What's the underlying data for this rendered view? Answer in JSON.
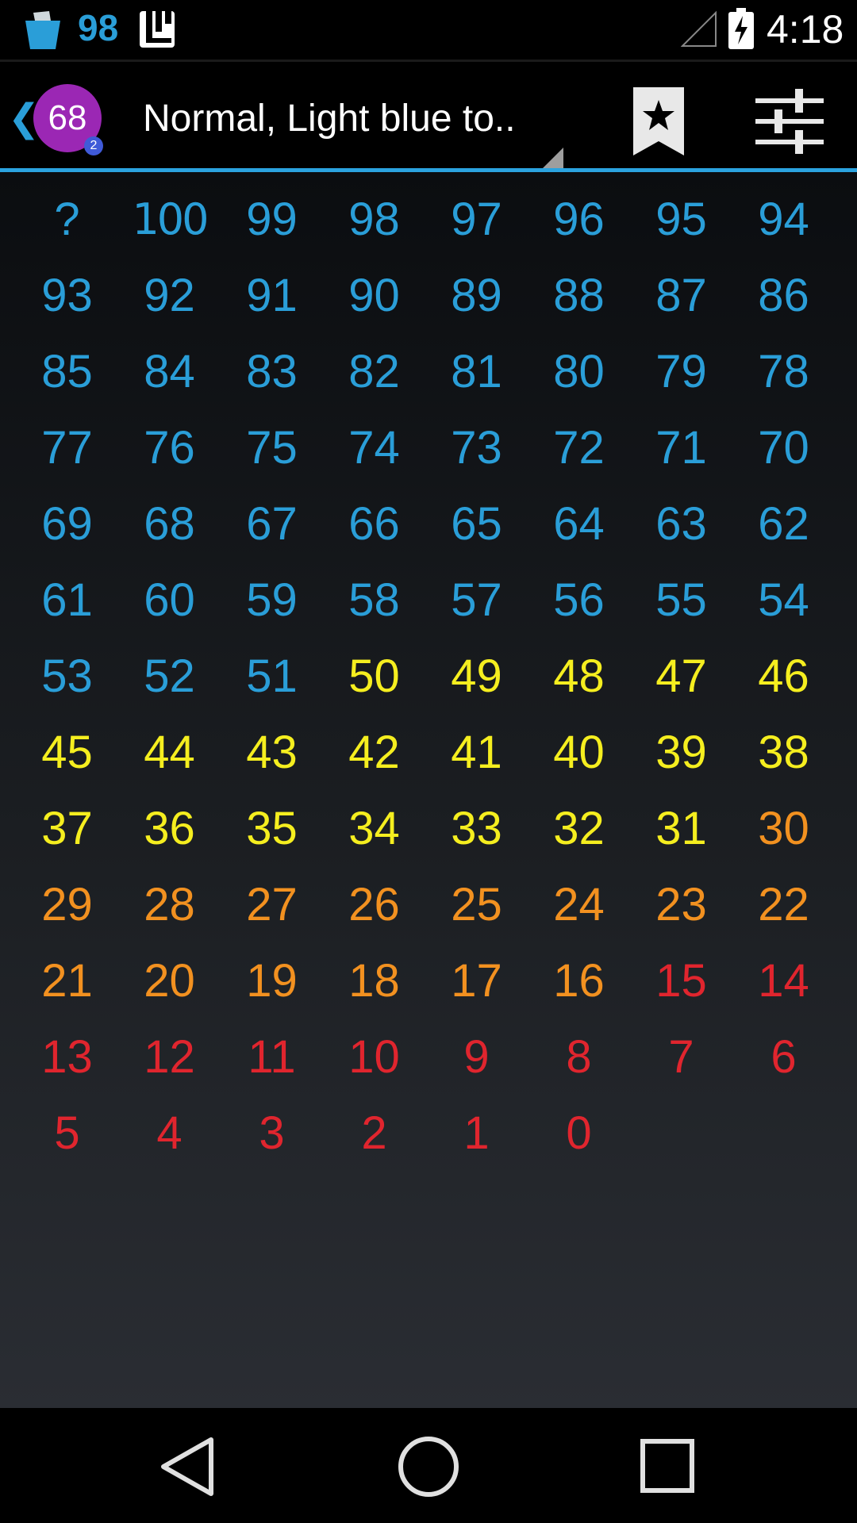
{
  "status_bar": {
    "battery_level": "98",
    "time": "4:18",
    "icons": [
      "bucket-app-icon",
      "notification-icon",
      "signal-icon",
      "battery-charging-icon"
    ]
  },
  "action_bar": {
    "back_glyph": "❮",
    "avatar_number": "68",
    "avatar_badge": "2",
    "spinner_value": "Normal, Light blue to..",
    "icons": [
      "bookmark-star-icon",
      "settings-sliders-icon"
    ]
  },
  "colors": {
    "accent": "#2ba3df",
    "avatar": "#9b27b4",
    "light_blue": "#2a9ed8",
    "yellow": "#f5ee1f",
    "orange": "#f29120",
    "red": "#e0252e"
  },
  "grid": {
    "cells": [
      {
        "label": "?",
        "color": "light_blue"
      },
      {
        "label": "100",
        "color": "light_blue"
      },
      {
        "label": "99",
        "color": "light_blue"
      },
      {
        "label": "98",
        "color": "light_blue"
      },
      {
        "label": "97",
        "color": "light_blue"
      },
      {
        "label": "96",
        "color": "light_blue"
      },
      {
        "label": "95",
        "color": "light_blue"
      },
      {
        "label": "94",
        "color": "light_blue"
      },
      {
        "label": "93",
        "color": "light_blue"
      },
      {
        "label": "92",
        "color": "light_blue"
      },
      {
        "label": "91",
        "color": "light_blue"
      },
      {
        "label": "90",
        "color": "light_blue"
      },
      {
        "label": "89",
        "color": "light_blue"
      },
      {
        "label": "88",
        "color": "light_blue"
      },
      {
        "label": "87",
        "color": "light_blue"
      },
      {
        "label": "86",
        "color": "light_blue"
      },
      {
        "label": "85",
        "color": "light_blue"
      },
      {
        "label": "84",
        "color": "light_blue"
      },
      {
        "label": "83",
        "color": "light_blue"
      },
      {
        "label": "82",
        "color": "light_blue"
      },
      {
        "label": "81",
        "color": "light_blue"
      },
      {
        "label": "80",
        "color": "light_blue"
      },
      {
        "label": "79",
        "color": "light_blue"
      },
      {
        "label": "78",
        "color": "light_blue"
      },
      {
        "label": "77",
        "color": "light_blue"
      },
      {
        "label": "76",
        "color": "light_blue"
      },
      {
        "label": "75",
        "color": "light_blue"
      },
      {
        "label": "74",
        "color": "light_blue"
      },
      {
        "label": "73",
        "color": "light_blue"
      },
      {
        "label": "72",
        "color": "light_blue"
      },
      {
        "label": "71",
        "color": "light_blue"
      },
      {
        "label": "70",
        "color": "light_blue"
      },
      {
        "label": "69",
        "color": "light_blue"
      },
      {
        "label": "68",
        "color": "light_blue"
      },
      {
        "label": "67",
        "color": "light_blue"
      },
      {
        "label": "66",
        "color": "light_blue"
      },
      {
        "label": "65",
        "color": "light_blue"
      },
      {
        "label": "64",
        "color": "light_blue"
      },
      {
        "label": "63",
        "color": "light_blue"
      },
      {
        "label": "62",
        "color": "light_blue"
      },
      {
        "label": "61",
        "color": "light_blue"
      },
      {
        "label": "60",
        "color": "light_blue"
      },
      {
        "label": "59",
        "color": "light_blue"
      },
      {
        "label": "58",
        "color": "light_blue"
      },
      {
        "label": "57",
        "color": "light_blue"
      },
      {
        "label": "56",
        "color": "light_blue"
      },
      {
        "label": "55",
        "color": "light_blue"
      },
      {
        "label": "54",
        "color": "light_blue"
      },
      {
        "label": "53",
        "color": "light_blue"
      },
      {
        "label": "52",
        "color": "light_blue"
      },
      {
        "label": "51",
        "color": "light_blue"
      },
      {
        "label": "50",
        "color": "yellow"
      },
      {
        "label": "49",
        "color": "yellow"
      },
      {
        "label": "48",
        "color": "yellow"
      },
      {
        "label": "47",
        "color": "yellow"
      },
      {
        "label": "46",
        "color": "yellow"
      },
      {
        "label": "45",
        "color": "yellow"
      },
      {
        "label": "44",
        "color": "yellow"
      },
      {
        "label": "43",
        "color": "yellow"
      },
      {
        "label": "42",
        "color": "yellow"
      },
      {
        "label": "41",
        "color": "yellow"
      },
      {
        "label": "40",
        "color": "yellow"
      },
      {
        "label": "39",
        "color": "yellow"
      },
      {
        "label": "38",
        "color": "yellow"
      },
      {
        "label": "37",
        "color": "yellow"
      },
      {
        "label": "36",
        "color": "yellow"
      },
      {
        "label": "35",
        "color": "yellow"
      },
      {
        "label": "34",
        "color": "yellow"
      },
      {
        "label": "33",
        "color": "yellow"
      },
      {
        "label": "32",
        "color": "yellow"
      },
      {
        "label": "31",
        "color": "yellow"
      },
      {
        "label": "30",
        "color": "orange"
      },
      {
        "label": "29",
        "color": "orange"
      },
      {
        "label": "28",
        "color": "orange"
      },
      {
        "label": "27",
        "color": "orange"
      },
      {
        "label": "26",
        "color": "orange"
      },
      {
        "label": "25",
        "color": "orange"
      },
      {
        "label": "24",
        "color": "orange"
      },
      {
        "label": "23",
        "color": "orange"
      },
      {
        "label": "22",
        "color": "orange"
      },
      {
        "label": "21",
        "color": "orange"
      },
      {
        "label": "20",
        "color": "orange"
      },
      {
        "label": "19",
        "color": "orange"
      },
      {
        "label": "18",
        "color": "orange"
      },
      {
        "label": "17",
        "color": "orange"
      },
      {
        "label": "16",
        "color": "orange"
      },
      {
        "label": "15",
        "color": "red"
      },
      {
        "label": "14",
        "color": "red"
      },
      {
        "label": "13",
        "color": "red"
      },
      {
        "label": "12",
        "color": "red"
      },
      {
        "label": "11",
        "color": "red"
      },
      {
        "label": "10",
        "color": "red"
      },
      {
        "label": "9",
        "color": "red"
      },
      {
        "label": "8",
        "color": "red"
      },
      {
        "label": "7",
        "color": "red"
      },
      {
        "label": "6",
        "color": "red"
      },
      {
        "label": "5",
        "color": "red"
      },
      {
        "label": "4",
        "color": "red"
      },
      {
        "label": "3",
        "color": "red"
      },
      {
        "label": "2",
        "color": "red"
      },
      {
        "label": "1",
        "color": "red"
      },
      {
        "label": "0",
        "color": "red"
      }
    ]
  },
  "nav_bar": {
    "icons": [
      "back-triangle-icon",
      "home-circle-icon",
      "recent-apps-square-icon"
    ]
  }
}
